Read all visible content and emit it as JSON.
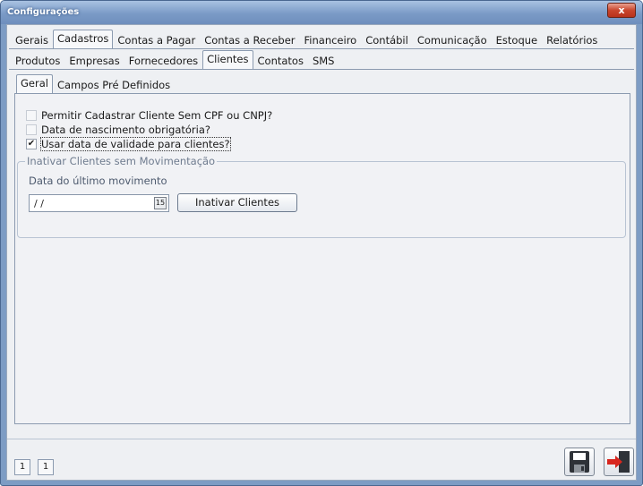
{
  "window": {
    "title": "Configurações",
    "close_label": "x"
  },
  "main_tabs": [
    "Gerais",
    "Cadastros",
    "Contas a Pagar",
    "Contas a Receber",
    "Financeiro",
    "Contábil",
    "Comunicação",
    "Estoque",
    "Relatórios"
  ],
  "main_tab_active": "Cadastros",
  "sub_tabs": [
    "Produtos",
    "Empresas",
    "Fornecedores",
    "Clientes",
    "Contatos",
    "SMS"
  ],
  "sub_tab_active": "Clientes",
  "inner_tabs": [
    "Geral",
    "Campos Pré Definidos"
  ],
  "inner_tab_active": "Geral",
  "options": [
    {
      "label": "Permitir Cadastrar Cliente Sem CPF ou CNPJ?",
      "checked": false
    },
    {
      "label": "Data de nascimento obrigatória?",
      "checked": false
    },
    {
      "label": "Usar data de validade para clientes?",
      "checked": true
    }
  ],
  "inactivate_group": {
    "title": "Inativar Clientes sem Movimentação",
    "date_label": "Data do último movimento",
    "date_value": " /  /",
    "button_label": "Inativar Clientes"
  },
  "footer": {
    "pager_current": "1",
    "pager_total": "1"
  },
  "colors": {
    "title_bar": "#7a9ac6",
    "close_button": "#c9452c",
    "save_icon": "#2e3238",
    "exit_icon": "#d8261e"
  }
}
